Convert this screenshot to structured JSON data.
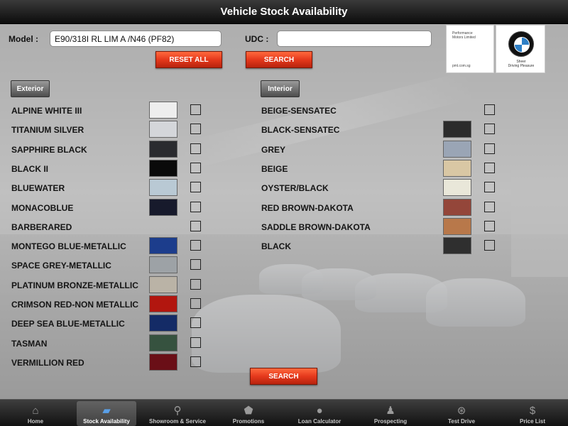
{
  "title": "Vehicle Stock Availability",
  "form": {
    "model_label": "Model :",
    "model_value": "E90/318I RL LIM A /N46 (PF82)",
    "udc_label": "UDC :",
    "udc_value": "",
    "reset_label": "RESET ALL",
    "search_label": "SEARCH",
    "bottom_search_label": "SEARCH"
  },
  "logos": {
    "pml_name_line1": "Performance",
    "pml_name_line2": "Motors Limited",
    "pml_url": "pml.com.sg",
    "bmw_tagline_line1": "Sheer",
    "bmw_tagline_line2": "Driving Pleasure"
  },
  "exterior": {
    "button_label": "Exterior",
    "colors": [
      {
        "name": "ALPINE WHITE III",
        "swatch": "#eeeeee"
      },
      {
        "name": "TITANIUM SILVER",
        "swatch": "#d4d6da"
      },
      {
        "name": "SAPPHIRE BLACK",
        "swatch": "#2a2b2f"
      },
      {
        "name": "BLACK II",
        "swatch": "#0a0a0a"
      },
      {
        "name": "BLUEWATER",
        "swatch": "#b9c9d4"
      },
      {
        "name": "MONACOBLUE",
        "swatch": "#171a2c"
      },
      {
        "name": "BARBERARED",
        "swatch": ""
      },
      {
        "name": "MONTEGO BLUE-METALLIC",
        "swatch": "#1c3d8c"
      },
      {
        "name": "SPACE GREY-METALLIC",
        "swatch": "#9da2a6"
      },
      {
        "name": "PLATINUM BRONZE-METALLIC",
        "swatch": "#bab3a6"
      },
      {
        "name": "CRIMSON RED-NON METALLIC",
        "swatch": "#b2160f"
      },
      {
        "name": "DEEP SEA BLUE-METALLIC",
        "swatch": "#142b66"
      },
      {
        "name": "TASMAN",
        "swatch": "#36523f"
      },
      {
        "name": "VERMILLION RED",
        "swatch": "#6a0f17"
      }
    ]
  },
  "interior": {
    "button_label": "Interior",
    "colors": [
      {
        "name": "BEIGE-SENSATEC",
        "swatch": ""
      },
      {
        "name": "BLACK-SENSATEC",
        "swatch": "#2b2b2b"
      },
      {
        "name": "GREY",
        "swatch": "#9aa5b5"
      },
      {
        "name": "BEIGE",
        "swatch": "#d9c7a4"
      },
      {
        "name": "OYSTER/BLACK",
        "swatch": "#e9e7d9"
      },
      {
        "name": "RED BROWN-DAKOTA",
        "swatch": "#94463a"
      },
      {
        "name": "SADDLE BROWN-DAKOTA",
        "swatch": "#b8784a"
      },
      {
        "name": "BLACK",
        "swatch": "#2f2f2f"
      }
    ]
  },
  "tabbar": [
    {
      "label": "Home",
      "icon": "home-icon",
      "glyph": "⌂",
      "active": false
    },
    {
      "label": "Stock Availability",
      "icon": "document-icon",
      "glyph": "▰",
      "active": true
    },
    {
      "label": "Showroom & Service",
      "icon": "magnifier-icon",
      "glyph": "⚲",
      "active": false
    },
    {
      "label": "Promotions",
      "icon": "tag-icon",
      "glyph": "⬟",
      "active": false
    },
    {
      "label": "Loan Calculator",
      "icon": "speech-bubble-icon",
      "glyph": "●",
      "active": false
    },
    {
      "label": "Prospecting",
      "icon": "person-icon",
      "glyph": "♟",
      "active": false
    },
    {
      "label": "Test Drive",
      "icon": "steering-wheel-icon",
      "glyph": "⊛",
      "active": false
    },
    {
      "label": "Price List",
      "icon": "dollar-icon",
      "glyph": "$",
      "active": false
    }
  ]
}
